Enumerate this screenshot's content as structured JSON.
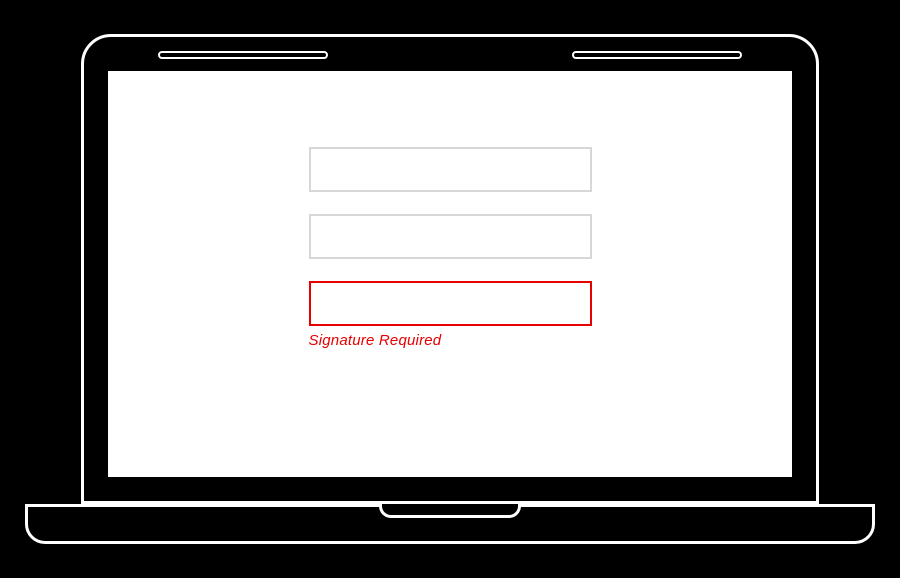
{
  "form": {
    "fields": [
      {
        "value": ""
      },
      {
        "value": ""
      },
      {
        "value": "",
        "error": true
      }
    ],
    "error_message": "Signature Required"
  }
}
